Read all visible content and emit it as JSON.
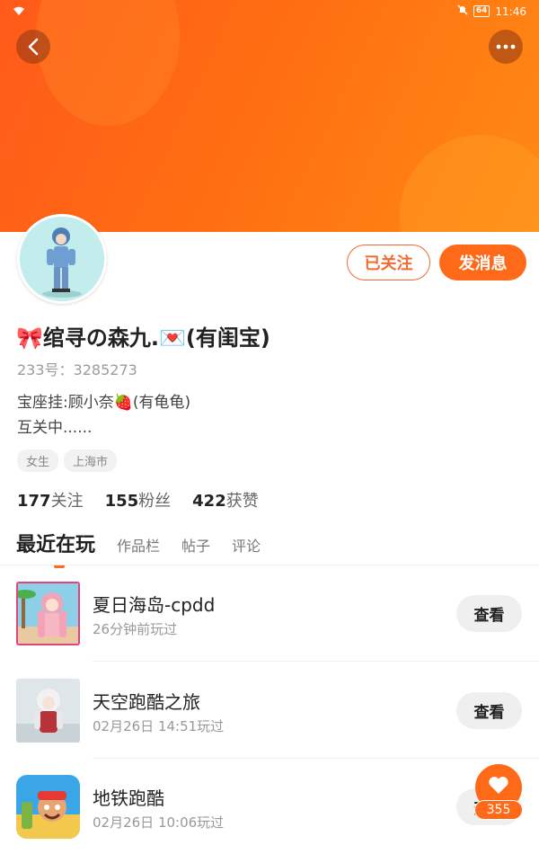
{
  "status_bar": {
    "time": "11:46",
    "battery": "64"
  },
  "profile": {
    "follow_label": "已关注",
    "message_label": "发消息",
    "username": "🎀绾寻の森九.💌(有闺宝)",
    "id_text": "233号：3285273",
    "bio_lines": [
      "宝座挂:顾小奈🍓(有龟龟)",
      "互关中......"
    ],
    "tags": [
      "女生",
      "上海市"
    ],
    "stats": [
      {
        "num": "177",
        "label": "关注"
      },
      {
        "num": "155",
        "label": "粉丝"
      },
      {
        "num": "422",
        "label": "获赞"
      }
    ]
  },
  "tabs": [
    "最近在玩",
    "作品栏",
    "帖子",
    "评论"
  ],
  "games": [
    {
      "name": "夏日海岛-cpdd",
      "time": "26分钟前玩过",
      "action": "查看"
    },
    {
      "name": "天空跑酷之旅",
      "time": "02月26日 14:51玩过",
      "action": "查看"
    },
    {
      "name": "地铁跑酷",
      "time": "02月26日 10:06玩过",
      "action": "查看"
    }
  ],
  "like_count": "355",
  "colors": {
    "accent": "#ff6a18",
    "banner": "#ff6d12"
  }
}
